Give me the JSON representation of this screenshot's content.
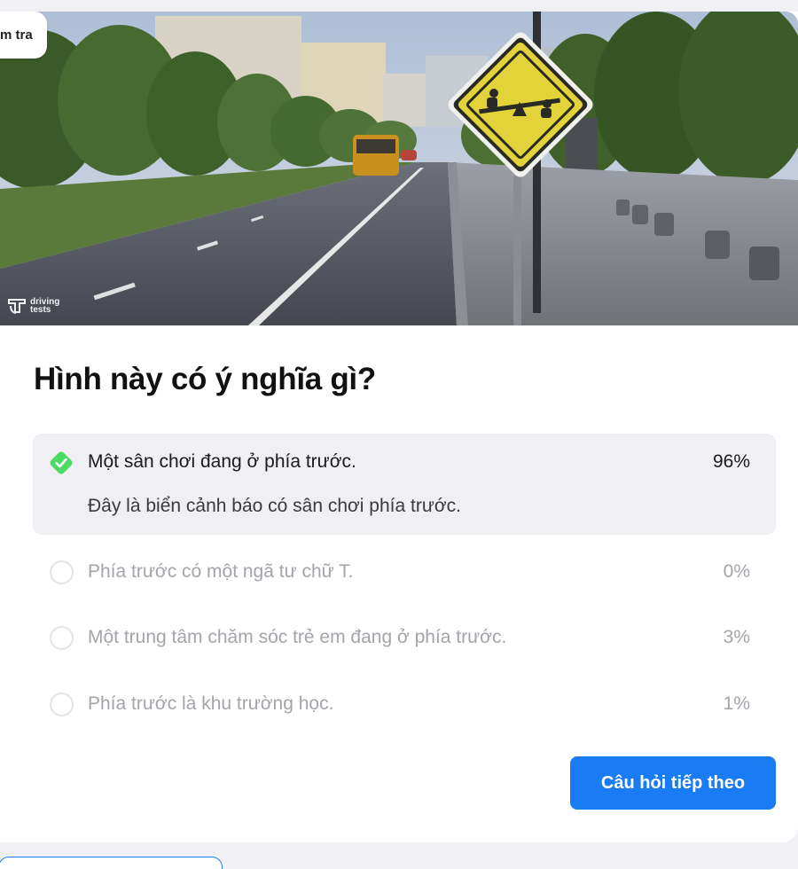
{
  "badge": {
    "label": "m tra"
  },
  "watermark": {
    "line1": "driving",
    "line2": "tests"
  },
  "question": {
    "title": "Hình này có ý nghĩa gì?"
  },
  "answers": [
    {
      "text": "Một sân chơi đang ở phía trước.",
      "percent": "96%",
      "state": "correct",
      "explanation": "Đây là biển cảnh báo có sân chơi phía trước."
    },
    {
      "text": "Phía trước có một ngã tư chữ T.",
      "percent": "0%",
      "state": "unselected"
    },
    {
      "text": "Một trung tâm chăm sóc trẻ em đang ở phía trước.",
      "percent": "3%",
      "state": "unselected"
    },
    {
      "text": "Phía trước là khu trường học.",
      "percent": "1%",
      "state": "unselected"
    }
  ],
  "next_button": {
    "label": "Câu hỏi tiếp theo"
  },
  "colors": {
    "accent": "#1a7cf5",
    "correct": "#4cd964",
    "sign_yellow": "#e3d33a"
  }
}
